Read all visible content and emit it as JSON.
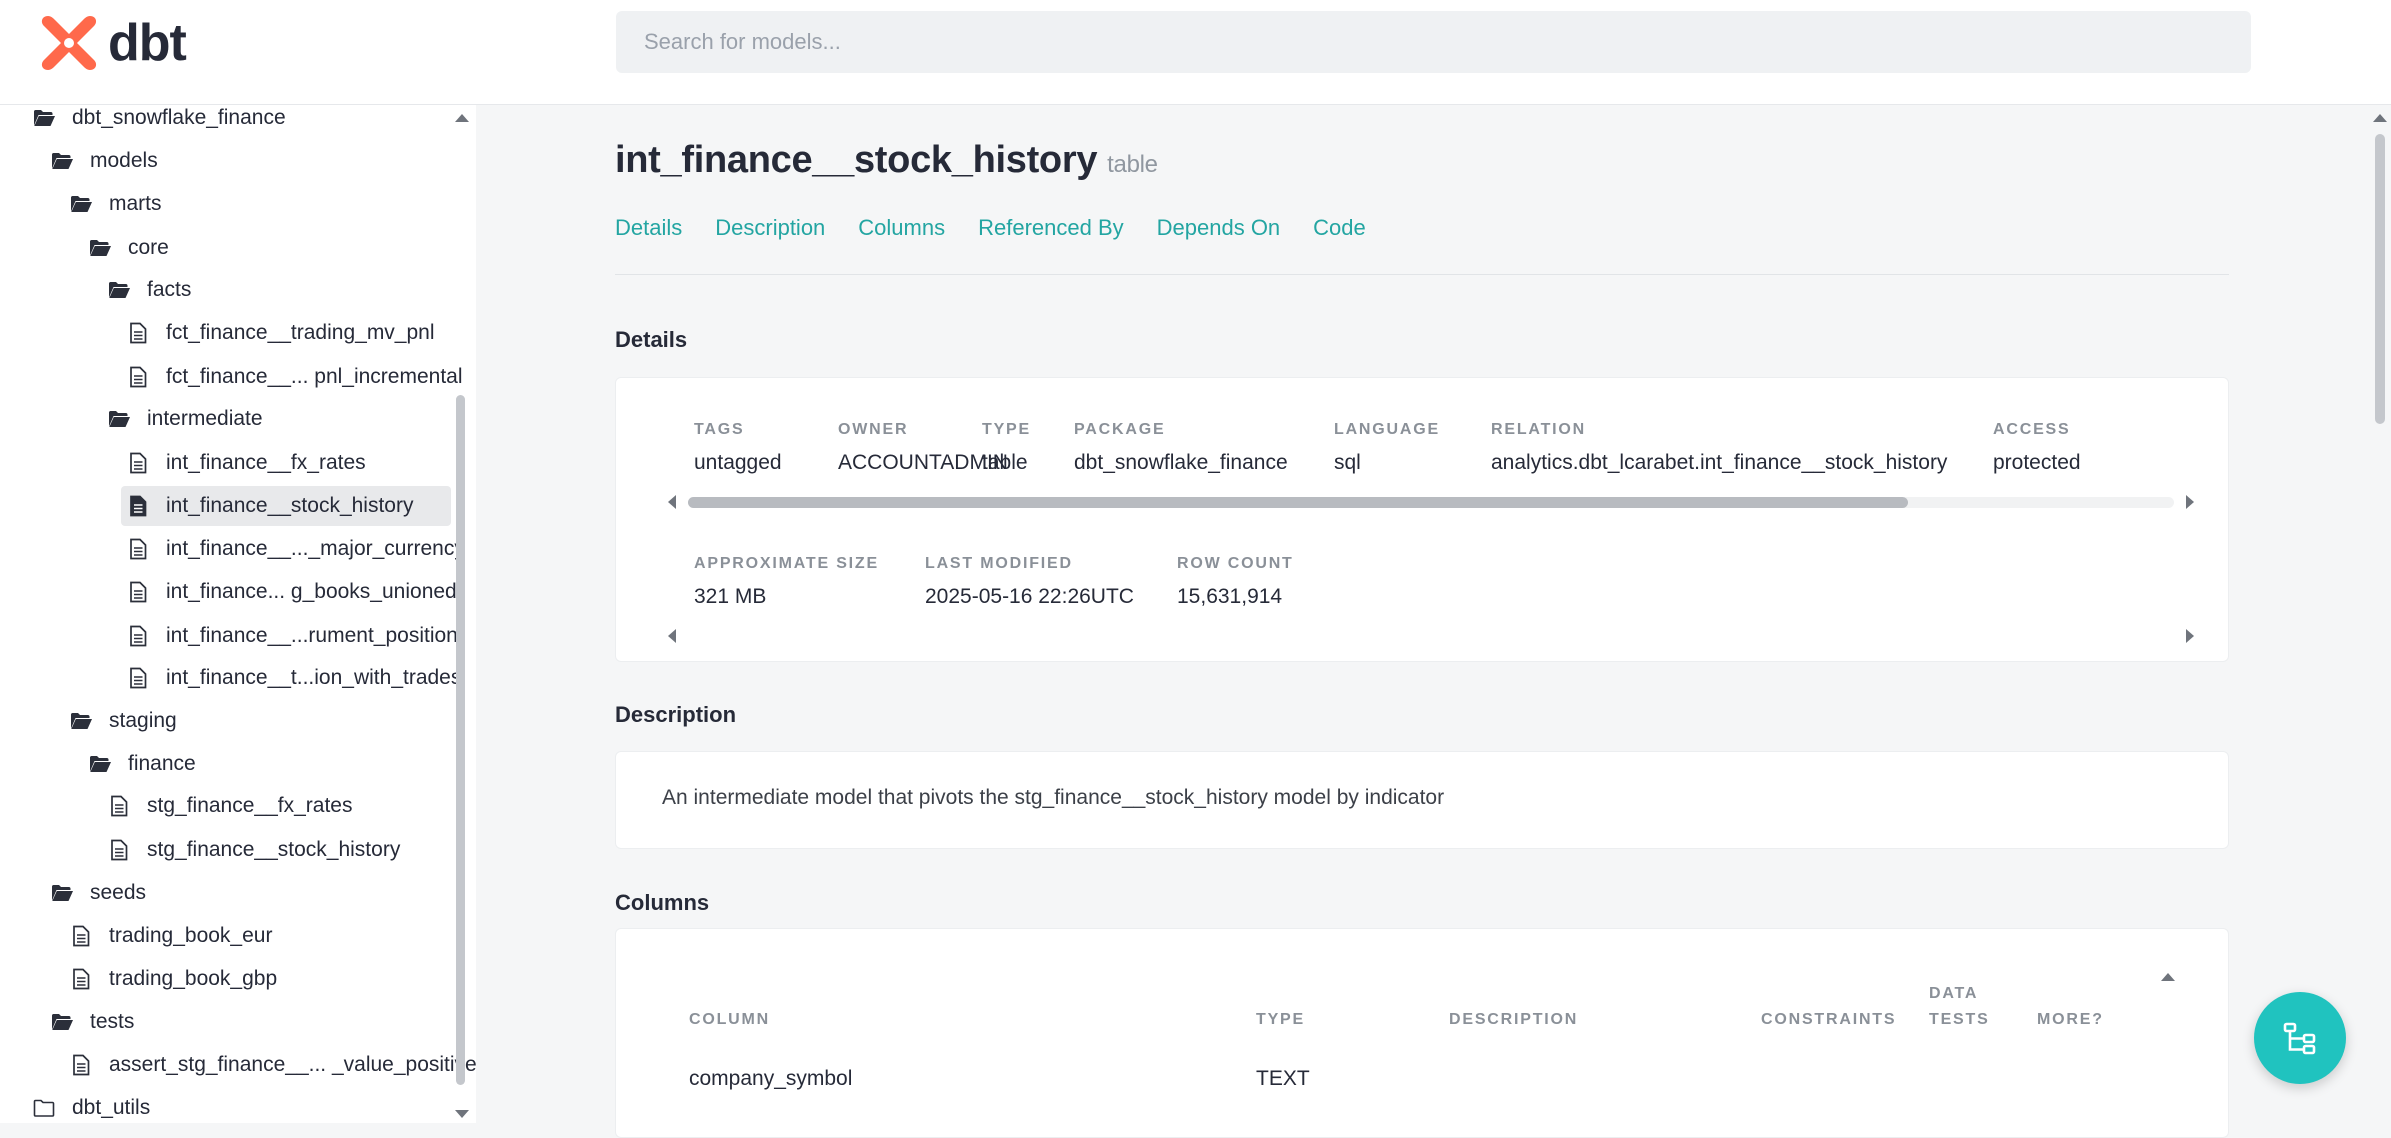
{
  "header": {
    "logo_text": "dbt",
    "search_placeholder": "Search for models..."
  },
  "sidebar": {
    "items": [
      {
        "label": "dbt_snowflake_finance",
        "icon": "folder-open-icon"
      },
      {
        "label": "models",
        "icon": "folder-open-icon"
      },
      {
        "label": "marts",
        "icon": "folder-open-icon"
      },
      {
        "label": "core",
        "icon": "folder-open-icon"
      },
      {
        "label": "facts",
        "icon": "folder-open-icon"
      },
      {
        "label": "fct_finance__trading_mv_pnl",
        "icon": "file-icon"
      },
      {
        "label": "fct_finance__... pnl_incremental",
        "icon": "file-icon"
      },
      {
        "label": "intermediate",
        "icon": "folder-open-icon"
      },
      {
        "label": "int_finance__fx_rates",
        "icon": "file-icon"
      },
      {
        "label": "int_finance__stock_history",
        "icon": "file-filled-icon"
      },
      {
        "label": "int_finance__..._major_currency",
        "icon": "file-icon"
      },
      {
        "label": "int_finance... g_books_unioned",
        "icon": "file-icon"
      },
      {
        "label": "int_finance__...rument_position",
        "icon": "file-icon"
      },
      {
        "label": "int_finance__t...ion_with_trades",
        "icon": "file-icon"
      },
      {
        "label": "staging",
        "icon": "folder-open-icon"
      },
      {
        "label": "finance",
        "icon": "folder-open-icon"
      },
      {
        "label": "stg_finance__fx_rates",
        "icon": "file-icon"
      },
      {
        "label": "stg_finance__stock_history",
        "icon": "file-icon"
      },
      {
        "label": "seeds",
        "icon": "folder-open-icon"
      },
      {
        "label": "trading_book_eur",
        "icon": "file-icon"
      },
      {
        "label": "trading_book_gbp",
        "icon": "file-icon"
      },
      {
        "label": "tests",
        "icon": "folder-open-icon"
      },
      {
        "label": "assert_stg_finance__... _value_positive",
        "icon": "file-icon"
      },
      {
        "label": "dbt_utils",
        "icon": "folder-closed-icon"
      }
    ]
  },
  "model": {
    "name": "int_finance__stock_history",
    "materialization": "table"
  },
  "tabs": [
    "Details",
    "Description",
    "Columns",
    "Referenced By",
    "Depends On",
    "Code"
  ],
  "details": {
    "section_title": "Details",
    "row1": [
      {
        "label": "Tags",
        "value": "untagged"
      },
      {
        "label": "Owner",
        "value": "ACCOUNTADMIN"
      },
      {
        "label": "Type",
        "value": "table"
      },
      {
        "label": "Package",
        "value": "dbt_snowflake_finance"
      },
      {
        "label": "Language",
        "value": "sql"
      },
      {
        "label": "Relation",
        "value": "analytics.dbt_lcarabet.int_finance__stock_history"
      },
      {
        "label": "Access",
        "value": "protected"
      }
    ],
    "row2": [
      {
        "label": "Approximate Size",
        "value": "321 MB"
      },
      {
        "label": "Last Modified",
        "value": "2025-05-16 22:26UTC"
      },
      {
        "label": "Row Count",
        "value": "15,631,914"
      }
    ]
  },
  "description": {
    "section_title": "Description",
    "text": "An intermediate model that pivots the stg_finance__stock_history model by indicator"
  },
  "columns": {
    "section_title": "Columns",
    "headers": [
      "Column",
      "Type",
      "Description",
      "Constraints",
      "Data Tests",
      "More?"
    ],
    "rows": [
      {
        "column": "company_symbol",
        "type": "TEXT",
        "description": ""
      }
    ]
  },
  "colors": {
    "accent": "#23a5a2",
    "brand_orange": "#ff694b",
    "fab": "#20c3bf"
  }
}
